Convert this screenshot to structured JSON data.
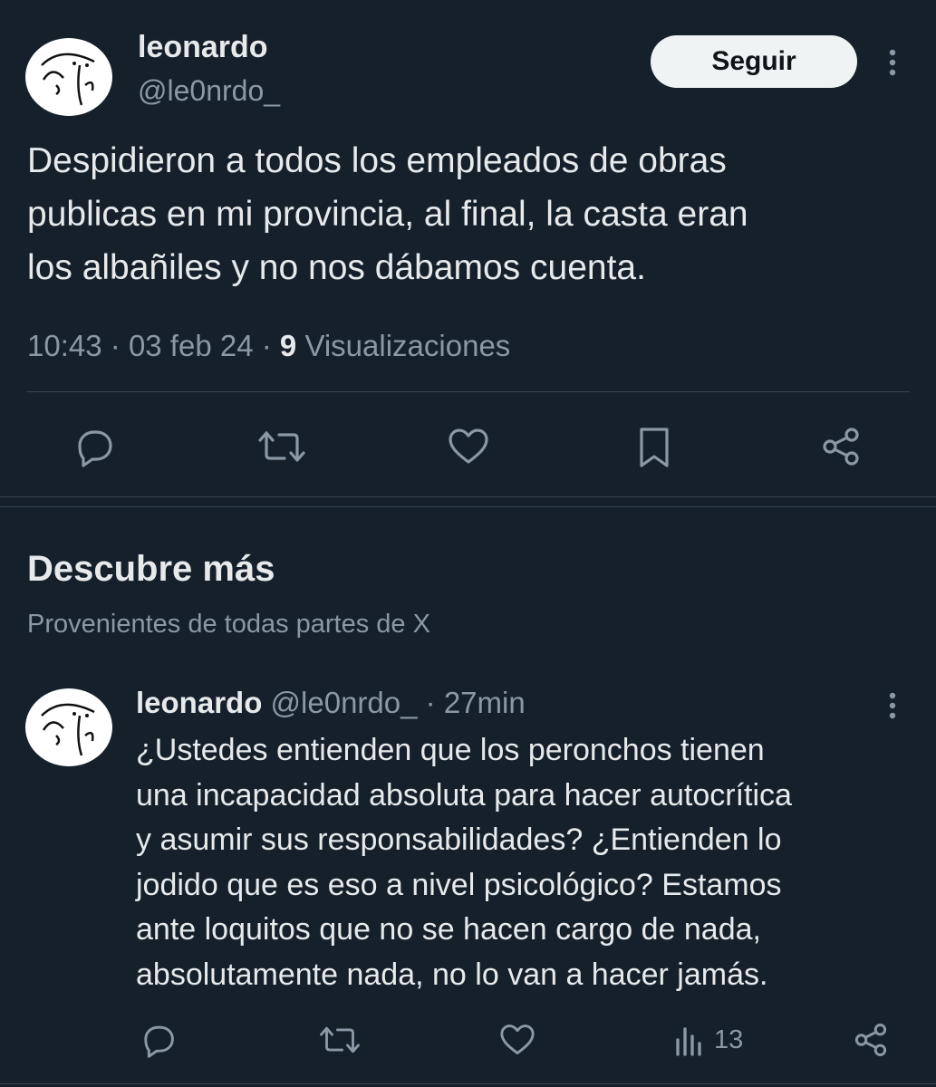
{
  "tweet": {
    "author_name": "leonardo",
    "author_handle": "@le0nrdo_",
    "follow_label": "Seguir",
    "text_lines": [
      "Despidieron a todos los empleados de obras",
      "publicas en mi provincia, al final, la casta eran",
      "los albañiles y no nos dábamos cuenta."
    ],
    "time": "10:43",
    "date": "03 feb 24",
    "views_count": "9",
    "views_label": "Visualizaciones",
    "actions": [
      "reply-icon",
      "retweet-icon",
      "like-icon",
      "bookmark-icon",
      "share-icon"
    ]
  },
  "discover": {
    "title": "Descubre más",
    "subtitle": "Provenientes de todas partes de X"
  },
  "suggested_tweet": {
    "author_name": "leonardo",
    "author_handle": "@le0nrdo_",
    "separator": "·",
    "age": "27min",
    "text_lines": [
      "¿Ustedes entienden que los peronchos tienen",
      "una incapacidad absoluta para hacer autocrítica",
      "y asumir sus responsabilidades? ¿Entienden lo",
      "jodido que es eso a nivel psicológico? Estamos",
      "ante loquitos que no se hacen cargo de nada,",
      "absolutamente nada, no lo van a hacer jamás."
    ],
    "views_count": "13",
    "actions": [
      "reply-icon",
      "retweet-icon",
      "like-icon",
      "views-icon",
      "share-icon"
    ]
  },
  "colors": {
    "background": "#15202b",
    "text": "#e7e9ea",
    "muted": "#8b98a5",
    "divider": "#38444d",
    "button_bg": "#eff3f4"
  }
}
